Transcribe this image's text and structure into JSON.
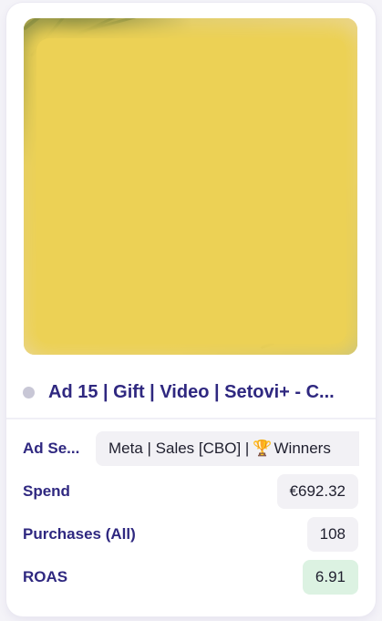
{
  "ad": {
    "title": "Ad 15 | Gift | Video | Setovi+ - C...",
    "status_color": "#c8c7d6",
    "thumbnail_icon": "blurred-video-thumbnail"
  },
  "fields": {
    "ad_set": {
      "label": "Ad Se...",
      "value_prefix": "Meta | Sales [CBO] |",
      "icon": "🏆",
      "value_suffix": "Winners"
    },
    "spend": {
      "label": "Spend",
      "value": "€692.32"
    },
    "purchases": {
      "label": "Purchases (All)",
      "value": "108"
    },
    "roas": {
      "label": "ROAS",
      "value": "6.91",
      "highlight_color": "#dcf2e2"
    }
  },
  "colors": {
    "label": "#2f2880",
    "value_bg": "#f2f1f5"
  }
}
